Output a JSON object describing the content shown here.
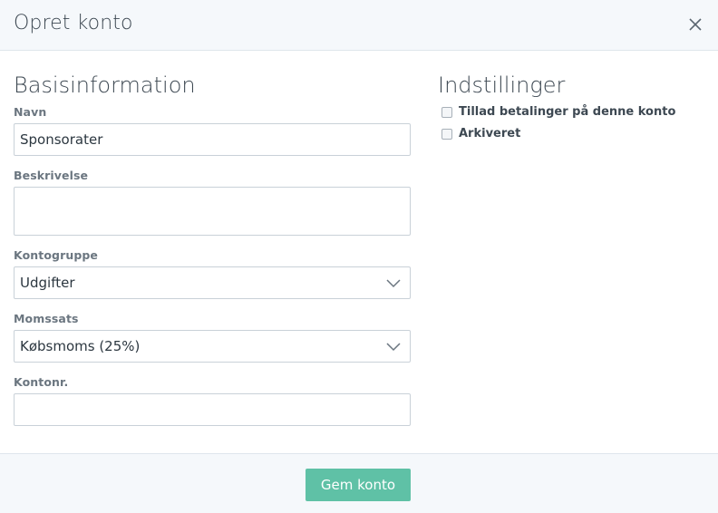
{
  "dialog": {
    "title": "Opret konto",
    "close_icon": "close-icon"
  },
  "basic": {
    "heading": "Basisinformation",
    "name": {
      "label": "Navn",
      "value": "Sponsorater"
    },
    "description": {
      "label": "Beskrivelse",
      "value": ""
    },
    "account_group": {
      "label": "Kontogruppe",
      "value": "Udgifter"
    },
    "vat_rate": {
      "label": "Momssats",
      "value": "Købsmoms (25%)"
    },
    "account_number": {
      "label": "Kontonr.",
      "value": ""
    }
  },
  "settings": {
    "heading": "Indstillinger",
    "options": [
      {
        "label": "Tillad betalinger på denne konto",
        "checked": false
      },
      {
        "label": "Arkiveret",
        "checked": false
      }
    ]
  },
  "footer": {
    "save_label": "Gem konto"
  },
  "colors": {
    "primary_button": "#5fc1a6",
    "header_bg": "#f5f8fb",
    "border": "#c9d1d8"
  }
}
